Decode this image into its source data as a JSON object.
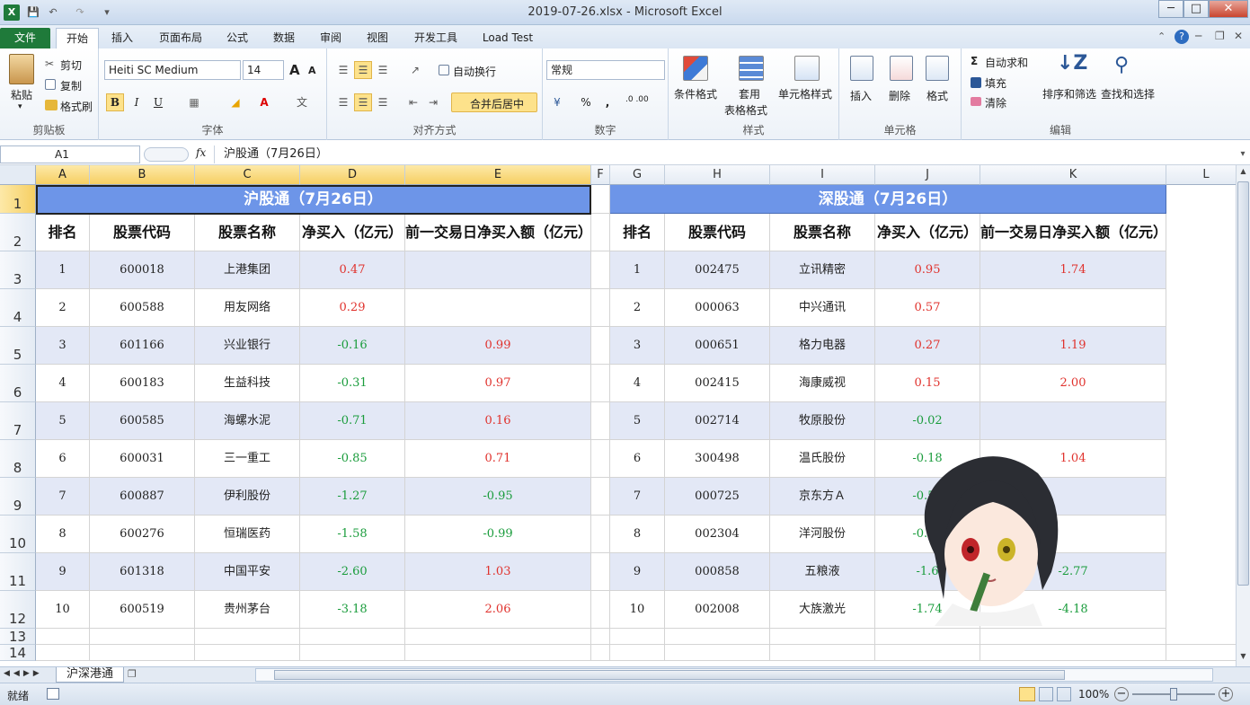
{
  "window": {
    "title": "2019-07-26.xlsx - Microsoft Excel"
  },
  "ribbon_tabs": [
    "文件",
    "开始",
    "插入",
    "页面布局",
    "公式",
    "数据",
    "审阅",
    "视图",
    "开发工具",
    "Load Test"
  ],
  "clipboard": {
    "paste": "粘贴",
    "cut": "剪切",
    "copy": "复制",
    "format_painter": "格式刷",
    "label": "剪贴板"
  },
  "font": {
    "name": "Heiti SC Medium",
    "size": "14",
    "bold": "B",
    "italic": "I",
    "underline": "U",
    "label": "字体",
    "grow": "A",
    "shrink": "A"
  },
  "alignment": {
    "wrap": "自动换行",
    "merge": "合并后居中",
    "label": "对齐方式"
  },
  "number": {
    "format": "常规",
    "percent": "%",
    "comma": ",",
    "inc_dec": "←.0 .00",
    "dec_dec": ".00 →.0",
    "label": "数字"
  },
  "styles": {
    "conditional": "条件格式",
    "table_line1": "套用",
    "table_line2": "表格格式",
    "cell_styles": "单元格样式",
    "label": "样式"
  },
  "cells": {
    "insert": "插入",
    "delete": "删除",
    "format": "格式",
    "label": "单元格"
  },
  "editing": {
    "autosum": "自动求和",
    "fill": "填充",
    "clear": "清除",
    "sort": "排序和筛选",
    "find": "查找和选择",
    "label": "编辑",
    "sigma": "Σ"
  },
  "formula_bar": {
    "name_box": "A1",
    "fx": "fx",
    "formula": "沪股通（7月26日）"
  },
  "columns": [
    "A",
    "B",
    "C",
    "D",
    "E",
    "F",
    "G",
    "H",
    "I",
    "J",
    "K",
    "L"
  ],
  "rows": [
    "1",
    "2",
    "3",
    "4",
    "5",
    "6",
    "7",
    "8",
    "9",
    "10",
    "11",
    "12",
    "13",
    "14"
  ],
  "sh": {
    "title": "沪股通（7月26日）",
    "headers": [
      "排名",
      "股票代码",
      "股票名称",
      "净买入（亿元）",
      "前一交易日净买入额（亿元）"
    ],
    "rows": [
      [
        "1",
        "600018",
        "上港集团",
        "0.47",
        ""
      ],
      [
        "2",
        "600588",
        "用友网络",
        "0.29",
        ""
      ],
      [
        "3",
        "601166",
        "兴业银行",
        "-0.16",
        "0.99"
      ],
      [
        "4",
        "600183",
        "生益科技",
        "-0.31",
        "0.97"
      ],
      [
        "5",
        "600585",
        "海螺水泥",
        "-0.71",
        "0.16"
      ],
      [
        "6",
        "600031",
        "三一重工",
        "-0.85",
        "0.71"
      ],
      [
        "7",
        "600887",
        "伊利股份",
        "-1.27",
        "-0.95"
      ],
      [
        "8",
        "600276",
        "恒瑞医药",
        "-1.58",
        "-0.99"
      ],
      [
        "9",
        "601318",
        "中国平安",
        "-2.60",
        "1.03"
      ],
      [
        "10",
        "600519",
        "贵州茅台",
        "-3.18",
        "2.06"
      ]
    ]
  },
  "sz": {
    "title": "深股通（7月26日）",
    "headers": [
      "排名",
      "股票代码",
      "股票名称",
      "净买入（亿元）",
      "前一交易日净买入额（亿元）"
    ],
    "rows": [
      [
        "1",
        "002475",
        "立讯精密",
        "0.95",
        "1.74"
      ],
      [
        "2",
        "000063",
        "中兴通讯",
        "0.57",
        ""
      ],
      [
        "3",
        "000651",
        "格力电器",
        "0.27",
        "1.19"
      ],
      [
        "4",
        "002415",
        "海康威视",
        "0.15",
        "2.00"
      ],
      [
        "5",
        "002714",
        "牧原股份",
        "-0.02",
        ""
      ],
      [
        "6",
        "300498",
        "温氏股份",
        "-0.18",
        "1.04"
      ],
      [
        "7",
        "000725",
        "京东方Ａ",
        "-0.57",
        ""
      ],
      [
        "8",
        "002304",
        "洋河股份",
        "-0.71",
        ""
      ],
      [
        "9",
        "000858",
        "五粮液",
        "-1.6",
        "-2.77"
      ],
      [
        "10",
        "002008",
        "大族激光",
        "-1.74",
        "-4.18"
      ]
    ]
  },
  "sheet_tab": "沪深港通",
  "status": {
    "ready": "就绪",
    "zoom": "100%"
  },
  "colors": {
    "header_band": "#6d95e8",
    "row_band": "#e3e8f6",
    "positive": "#e0322d",
    "negative": "#1a9c3c",
    "file_tab": "#1f7a3a"
  }
}
